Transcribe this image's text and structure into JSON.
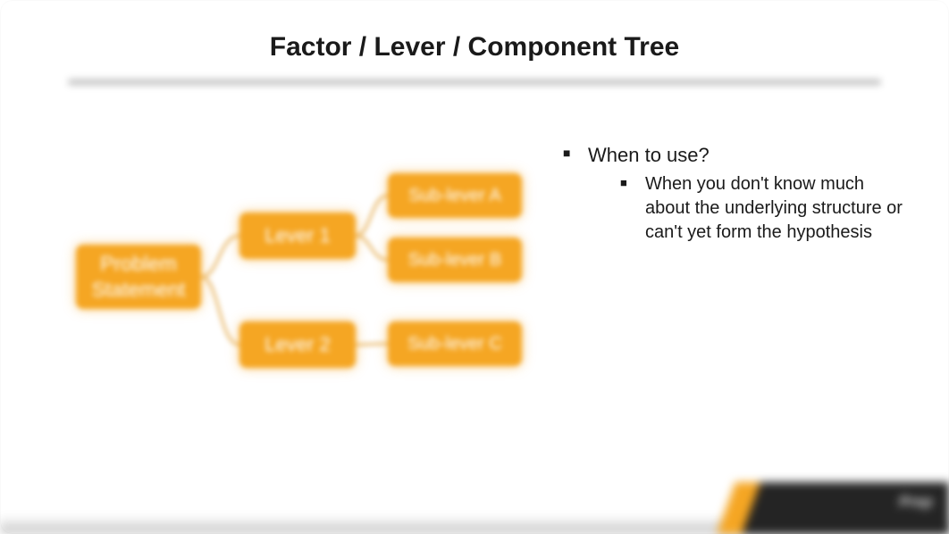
{
  "title": "Factor / Lever / Component Tree",
  "diagram": {
    "root": "Problem\nStatement",
    "lever1": "Lever 1",
    "lever2": "Lever 2",
    "subA": "Sub-lever A",
    "subB": "Sub-lever B",
    "subC": "Sub-lever C"
  },
  "bullets": {
    "heading": "When to use?",
    "sub1": "When you don't know much about the underlying structure or can't yet form the hypothesis"
  },
  "brand": "Prep"
}
